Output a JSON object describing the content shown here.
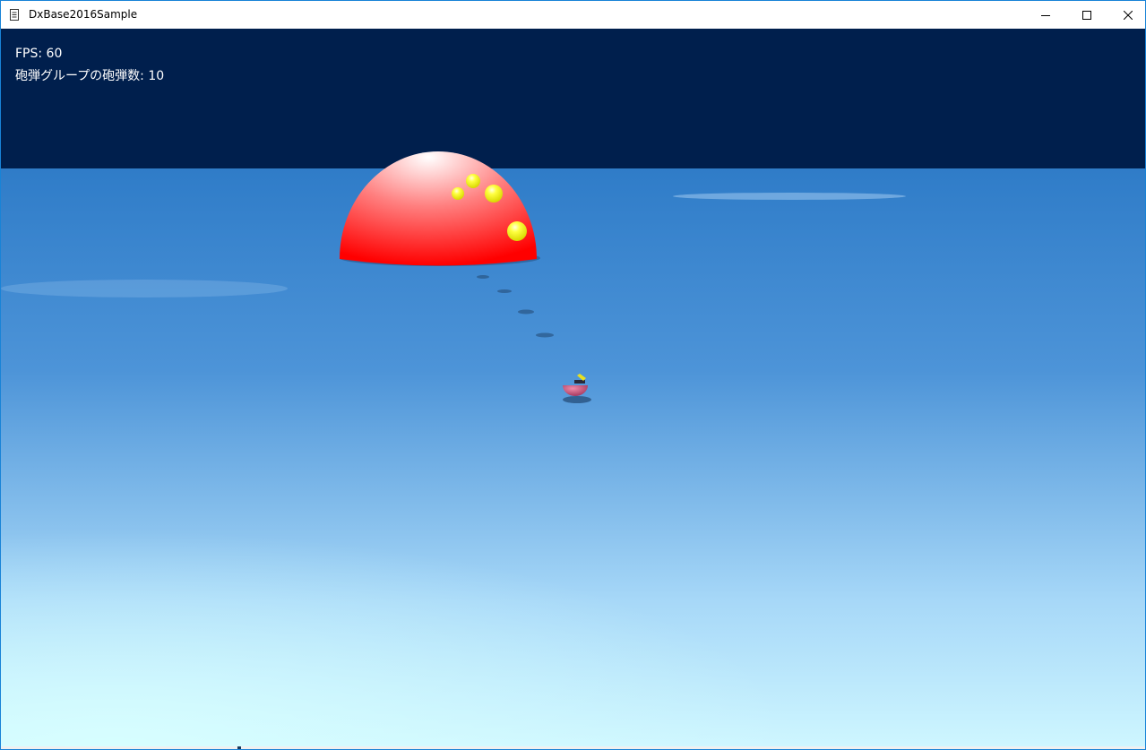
{
  "window": {
    "title": "DxBase2016Sample",
    "icon": "document-icon",
    "border_color": "#1883d7",
    "caption_buttons": [
      "minimize-icon",
      "maximize-icon",
      "close-icon"
    ]
  },
  "hud": {
    "fps_label": "FPS: 60",
    "shell_count_label": "砲弾グループの砲弾数: 10"
  },
  "scene": {
    "sky_color": "#001f4d",
    "ground_colors": [
      "#2f7cc8",
      "#4d94d8",
      "#a7d8f8",
      "#cef6ff"
    ],
    "dome_color": "#ff0000",
    "shell_color": "#ffff00",
    "cannon_color": "#c94a72"
  }
}
